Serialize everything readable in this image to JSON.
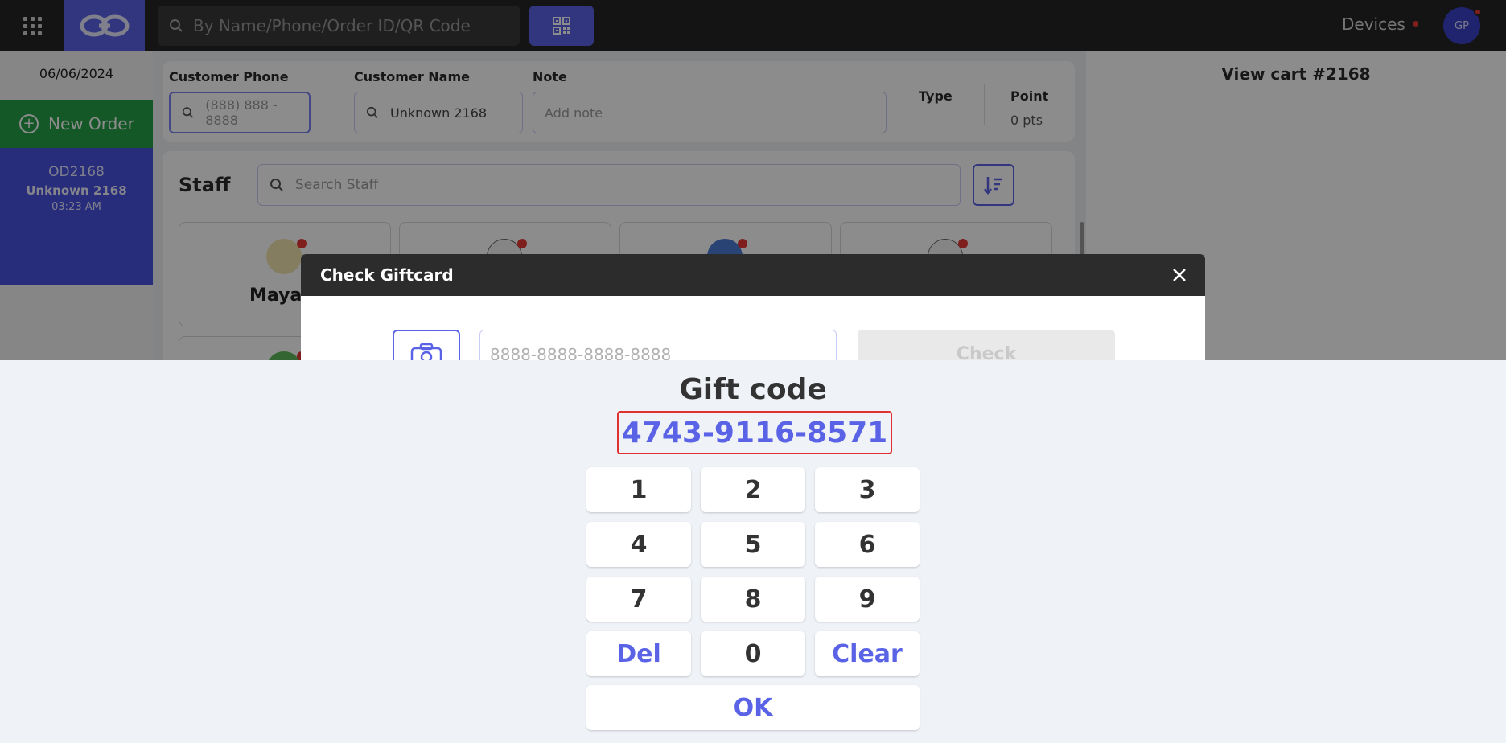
{
  "topbar": {
    "search_placeholder": "By Name/Phone/Order ID/QR Code",
    "devices_label": "Devices",
    "avatar_initials": "GP",
    "accent": "#5a63e6"
  },
  "sidebar": {
    "date": "06/06/2024",
    "new_order_label": "New Order",
    "order": {
      "id": "OD2168",
      "customer": "Unknown 2168",
      "time": "03:23 AM"
    }
  },
  "customer": {
    "phone_label": "Customer Phone",
    "phone_placeholder": "(888) 888 - 8888",
    "name_label": "Customer Name",
    "name_value": "Unknown 2168",
    "note_label": "Note",
    "note_placeholder": "Add note",
    "type_label": "Type",
    "point_label": "Point",
    "point_value": "0 pts"
  },
  "staff": {
    "title": "Staff",
    "search_placeholder": "Search Staff",
    "first_name": "Maya T"
  },
  "cart": {
    "title": "View cart #2168"
  },
  "modal": {
    "title": "Check Giftcard",
    "input_placeholder": "8888-8888-8888-8888",
    "check_label": "Check"
  },
  "keypad": {
    "title": "Gift code",
    "code": "4743-9116-8571",
    "keys": [
      "1",
      "2",
      "3",
      "4",
      "5",
      "6",
      "7",
      "8",
      "9",
      "Del",
      "0",
      "Clear"
    ],
    "ok_label": "OK"
  }
}
